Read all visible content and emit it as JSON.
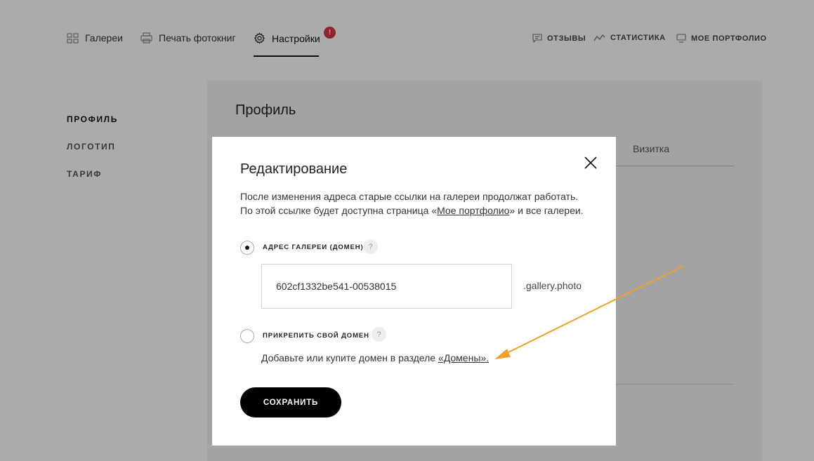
{
  "nav": {
    "galleries": "Галереи",
    "print": "Печать фотокниг",
    "settings": "Настройки",
    "settings_badge": "!",
    "reviews": "ОТЗЫВЫ",
    "stats": "СТАТИСТИКА",
    "portfolio": "МОЕ ПОРТФОЛИО"
  },
  "sidebar": {
    "items": [
      {
        "label": "ПРОФИЛЬ"
      },
      {
        "label": "ЛОГОТИП"
      },
      {
        "label": "ТАРИФ"
      }
    ]
  },
  "panel": {
    "title": "Профиль",
    "tab": "Визитка"
  },
  "modal": {
    "title": "Редактирование",
    "desc_line1": "После изменения адреса старые ссылки на галереи продолжат работать.",
    "desc_line2_before": "По этой ссылке будет доступна страница «",
    "desc_link": "Мое портфолио",
    "desc_line2_after": "» и все галереи.",
    "option1_label": "АДРЕС ГАЛЕРЕИ (ДОМЕН)",
    "option1_checked": true,
    "help": "?",
    "domain_value": "602cf1332be541-00538015",
    "domain_suffix": ".gallery.photo",
    "option2_label": "ПРИКРЕПИТЬ СВОЙ ДОМЕН",
    "option2_checked": false,
    "hint_before": "Добавьте или купите домен в разделе ",
    "hint_link": "«Домены».",
    "save_label": "СОХРАНИТЬ"
  },
  "colors": {
    "badge": "#d9363e",
    "arrow": "#f0a030",
    "save_button": "#000000"
  }
}
